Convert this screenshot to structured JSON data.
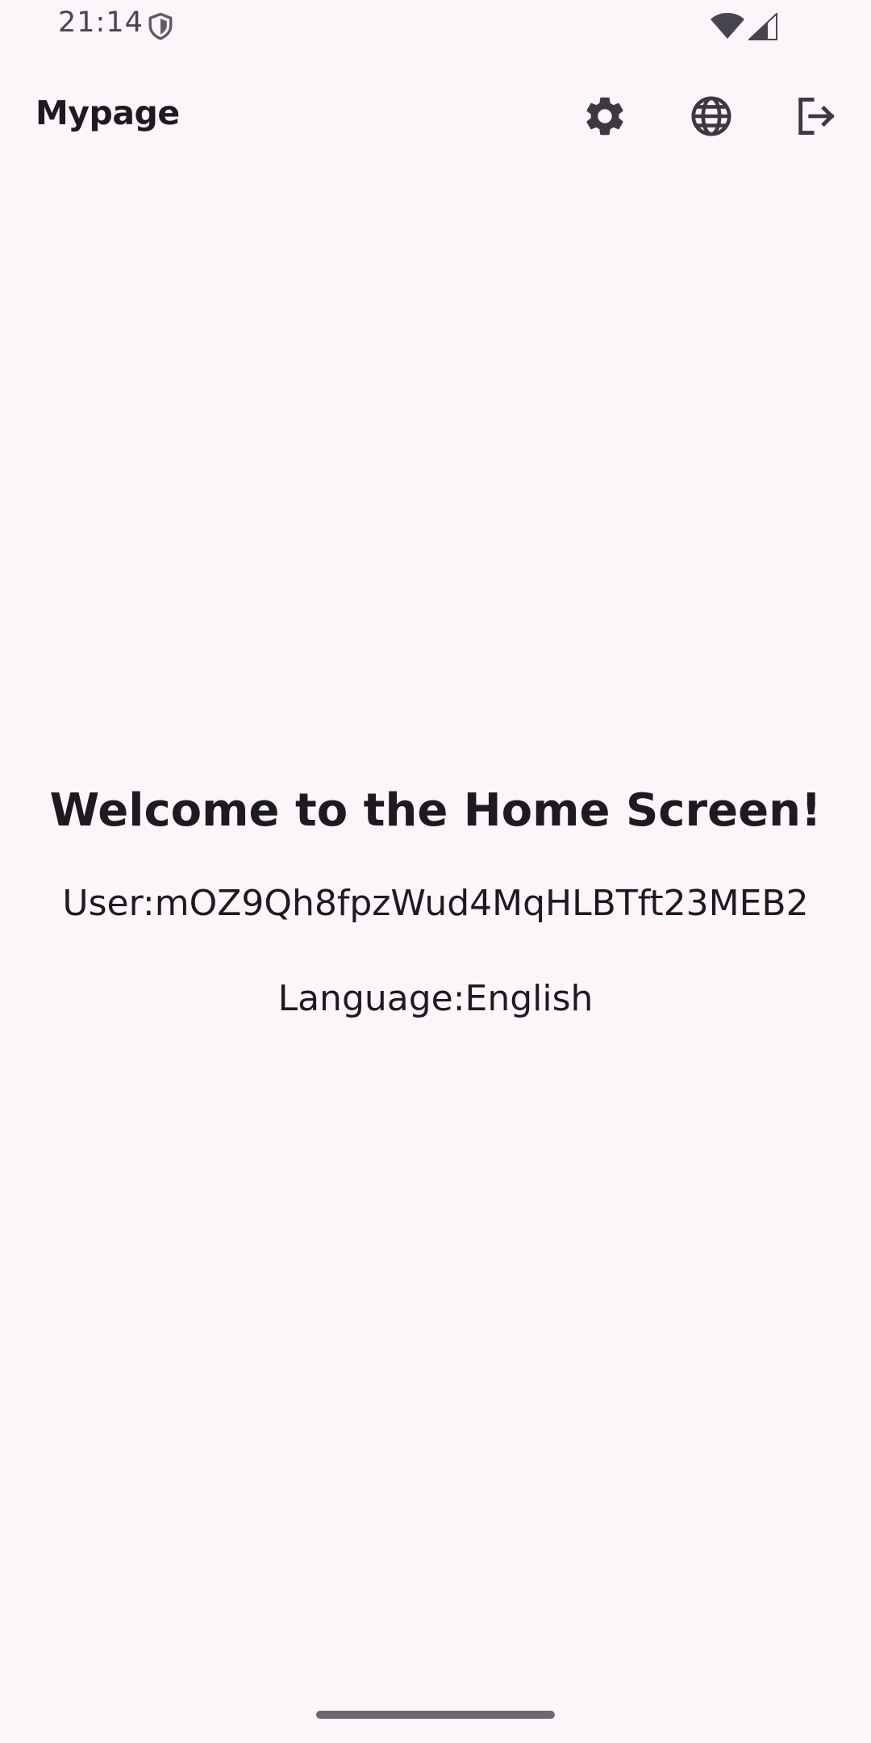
{
  "status_bar": {
    "time": "21:14",
    "icons": [
      "shield-icon",
      "wifi-icon",
      "cellular-signal-icon"
    ]
  },
  "app_bar": {
    "title": "Mypage",
    "actions": [
      {
        "name": "settings-button",
        "icon": "gear-icon"
      },
      {
        "name": "language-button",
        "icon": "globe-icon"
      },
      {
        "name": "logout-button",
        "icon": "logout-icon"
      }
    ]
  },
  "main": {
    "welcome": "Welcome to the Home Screen!",
    "user": "User:mOZ9Qh8fpzWud4MqHLBTft23MEB2",
    "language": "Language:English"
  },
  "colors": {
    "background": "#fcf6fb",
    "text": "#1d1b20",
    "icon": "#49454f"
  }
}
